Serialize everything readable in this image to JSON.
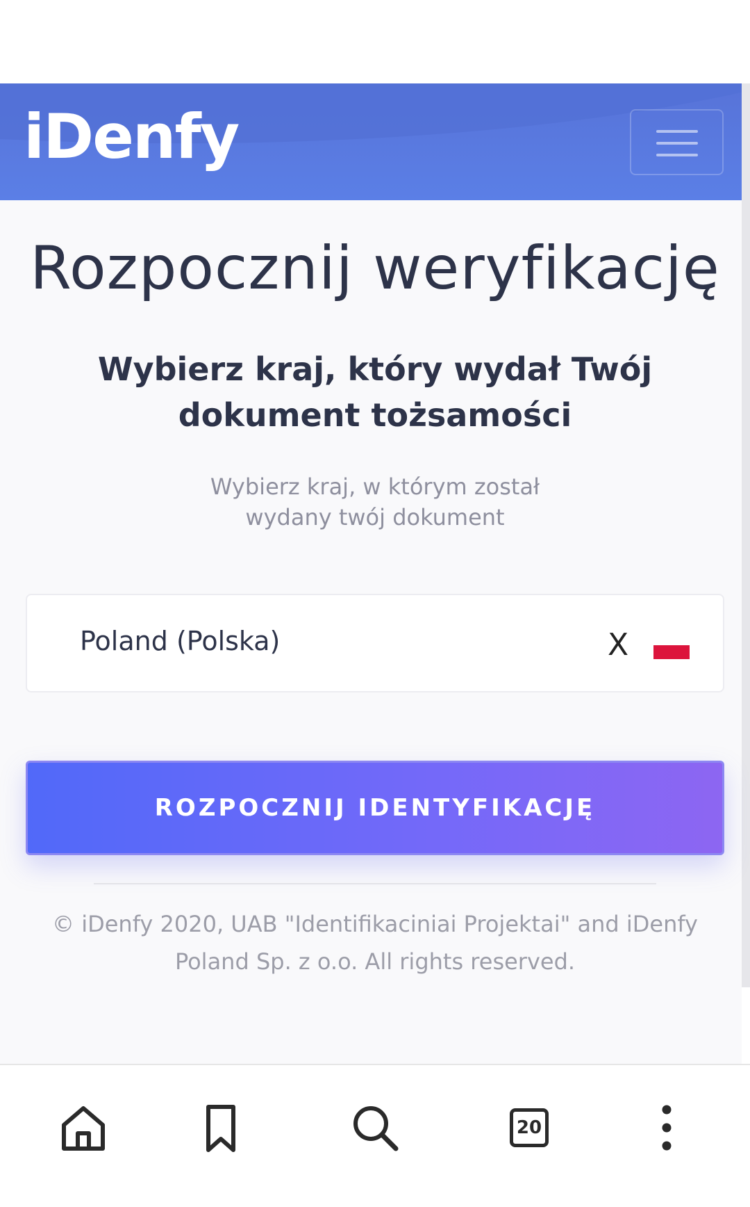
{
  "brand": {
    "logo_text": "iDenfy",
    "accent_color": "#5b7fe6",
    "button_gradient": [
      "#5169f9",
      "#8d66f2"
    ]
  },
  "header": {
    "menu_icon": "hamburger-icon"
  },
  "main": {
    "title": "Rozpocznij weryfikację",
    "subtitle": "Wybierz kraj, który wydał Twój dokument tożsamości",
    "hint": "Wybierz kraj, w którym został wydany twój dokument",
    "country_select": {
      "value": "Poland (Polska)",
      "clear_label": "X",
      "flag_icon": "poland-flag-icon"
    },
    "start_button_label": "ROZPOCZNIJ IDENTYFIKACJĘ",
    "copyright": "© iDenfy 2020, UAB \"Identifikaciniai Projektai\" and iDenfy Poland Sp. z o.o. All rights reserved."
  },
  "bottom_nav": {
    "items": [
      {
        "icon": "home-icon"
      },
      {
        "icon": "bookmark-icon"
      },
      {
        "icon": "search-icon"
      },
      {
        "icon": "tabs-icon",
        "count": "20"
      },
      {
        "icon": "more-vertical-icon"
      }
    ]
  }
}
